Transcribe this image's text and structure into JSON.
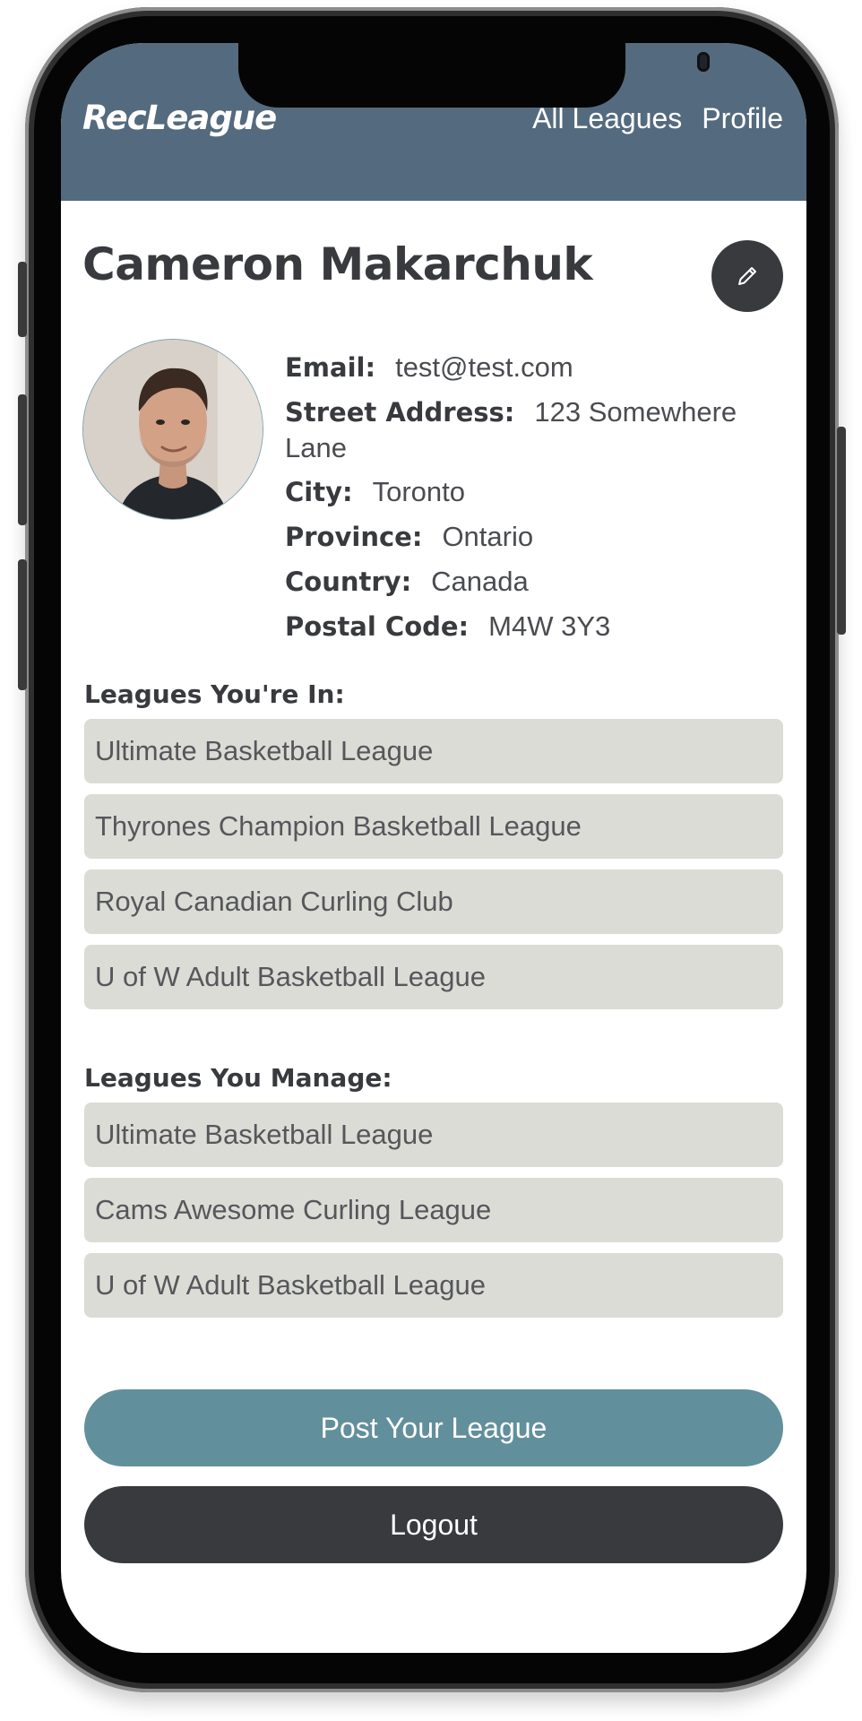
{
  "header": {
    "logo": "RecLeague",
    "nav": [
      {
        "label": "All Leagues"
      },
      {
        "label": "Profile"
      }
    ],
    "bg_color": "#546a7e"
  },
  "profile": {
    "name": "Cameron Makarchuk",
    "edit_icon": "pencil-icon",
    "fields": [
      {
        "label": "Email:",
        "value": "test@test.com"
      },
      {
        "label": "Street Address:",
        "value": "123 Somewhere Lane"
      },
      {
        "label": "City:",
        "value": "Toronto"
      },
      {
        "label": "Province:",
        "value": "Ontario"
      },
      {
        "label": "Country:",
        "value": "Canada"
      },
      {
        "label": "Postal Code:",
        "value": "M4W 3Y3"
      }
    ]
  },
  "leagues_in": {
    "title": "Leagues You're In:",
    "items": [
      "Ultimate Basketball League",
      "Thyrones Champion Basketball League",
      "Royal Canadian Curling Club",
      "U of W Adult Basketball League"
    ]
  },
  "leagues_manage": {
    "title": "Leagues You Manage:",
    "items": [
      "Ultimate Basketball League",
      "Cams Awesome Curling League",
      "U of W Adult Basketball League"
    ]
  },
  "actions": {
    "post_label": "Post Your League",
    "logout_label": "Logout",
    "post_color": "#628f9c",
    "logout_color": "#383a3d"
  }
}
